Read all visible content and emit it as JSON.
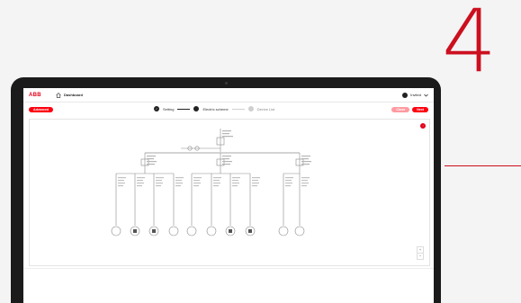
{
  "step_number": "4",
  "app": {
    "logo": "ABB",
    "home_label": "Dashboard",
    "user_label": "Invited"
  },
  "toolbar": {
    "left_button": "Advanced",
    "back_label": "Close",
    "next_label": "Next",
    "steps": [
      {
        "label": "Setting",
        "state": "done"
      },
      {
        "label": "Electric scheme",
        "state": "active"
      },
      {
        "label": "Device List",
        "state": "todo"
      }
    ]
  },
  "canvas": {
    "badge": "!",
    "zoom_in": "+",
    "zoom_out": "−"
  },
  "colors": {
    "brand_red": "#e2001a",
    "accent": "#ff000f",
    "laptop_body": "#1b1b1b"
  }
}
